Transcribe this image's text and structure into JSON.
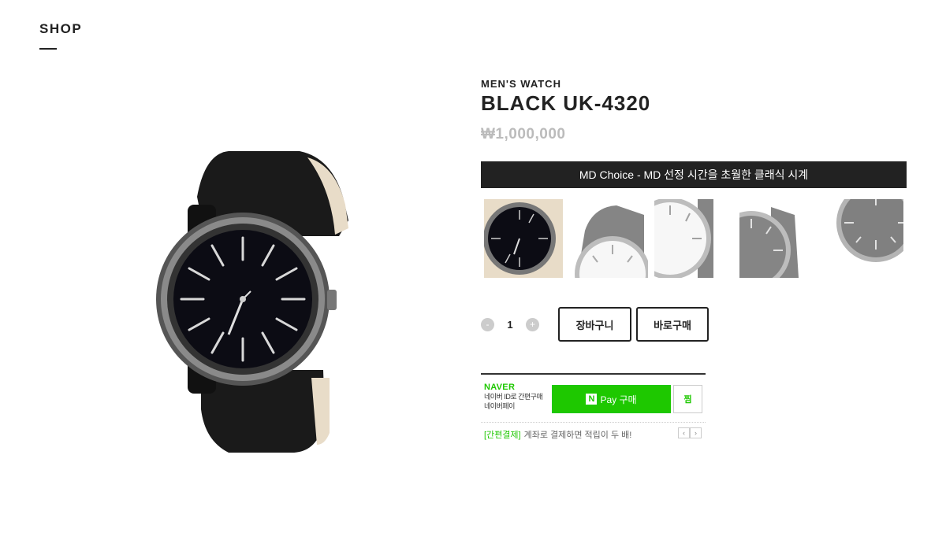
{
  "header": {
    "title": "SHOP"
  },
  "product": {
    "category": "MEN'S WATCH",
    "name": "BLACK UK-4320",
    "price": "₩1,000,000",
    "banner": "MD Choice - MD 선정 시간을 초월한 클래식 시계"
  },
  "quantity": {
    "minus": "-",
    "value": "1",
    "plus": "+"
  },
  "buttons": {
    "cart": "장바구니",
    "buy": "바로구매"
  },
  "npay": {
    "brand": "NAVER",
    "sub1": "네이버 ID로 간편구매",
    "sub2": "네이버페이",
    "n_icon": "N",
    "buy_label": "Pay 구매",
    "zzim": "찜",
    "promo_tag": "[간편결제]",
    "promo_text": "계좌로 결제하면 적립이 두 배!",
    "prev": "‹",
    "next": "›"
  }
}
